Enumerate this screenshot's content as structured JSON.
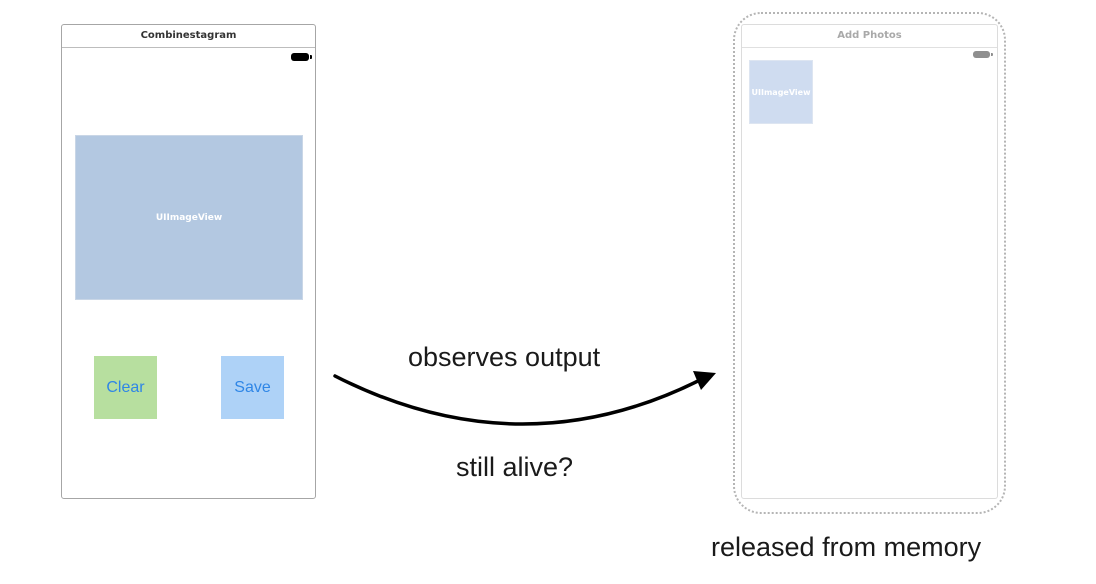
{
  "left_screen": {
    "nav_title": "Combinestagram",
    "image_view_label": "UIImageView",
    "clear_label": "Clear",
    "save_label": "Save"
  },
  "right_screen": {
    "nav_title": "Add Photos",
    "image_view_label": "UIImageView"
  },
  "labels": {
    "observes": "observes output",
    "alive": "still alive?",
    "released": "released from memory"
  },
  "colors": {
    "clear_button_bg": "#b7df9f",
    "save_button_bg": "#aed2f7",
    "image_view_bg": "#b3c8e1",
    "button_text": "#2f86e6"
  },
  "icons": {
    "battery": "battery-icon",
    "arrow": "arrow-icon"
  }
}
